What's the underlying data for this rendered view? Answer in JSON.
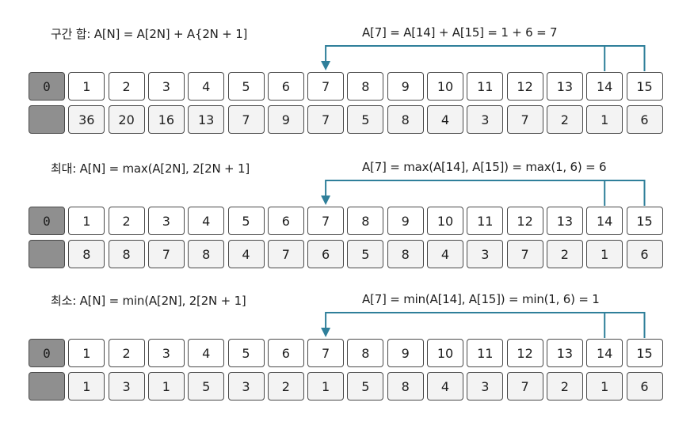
{
  "sections": [
    {
      "formula": "구간 합: A[N] = A[2N] + A{2N + 1]",
      "example": "A[7] = A[14] + A[15] = 1 + 6 = 7",
      "indices": [
        "0",
        "1",
        "2",
        "3",
        "4",
        "5",
        "6",
        "7",
        "8",
        "9",
        "10",
        "11",
        "12",
        "13",
        "14",
        "15"
      ],
      "values": [
        "",
        "36",
        "20",
        "16",
        "13",
        "7",
        "9",
        "7",
        "5",
        "8",
        "4",
        "3",
        "7",
        "2",
        "1",
        "6"
      ]
    },
    {
      "formula": "최대: A[N] = max(A[2N], 2[2N + 1]",
      "example": "A[7] = max(A[14], A[15]) = max(1, 6) = 6",
      "indices": [
        "0",
        "1",
        "2",
        "3",
        "4",
        "5",
        "6",
        "7",
        "8",
        "9",
        "10",
        "11",
        "12",
        "13",
        "14",
        "15"
      ],
      "values": [
        "",
        "8",
        "8",
        "7",
        "8",
        "4",
        "7",
        "6",
        "5",
        "8",
        "4",
        "3",
        "7",
        "2",
        "1",
        "6"
      ]
    },
    {
      "formula": "최소: A[N] = min(A[2N], 2[2N + 1]",
      "example": "A[7] = min(A[14], A[15]) = min(1, 6) = 1",
      "indices": [
        "0",
        "1",
        "2",
        "3",
        "4",
        "5",
        "6",
        "7",
        "8",
        "9",
        "10",
        "11",
        "12",
        "13",
        "14",
        "15"
      ],
      "values": [
        "",
        "1",
        "3",
        "1",
        "5",
        "3",
        "2",
        "1",
        "5",
        "8",
        "4",
        "3",
        "7",
        "2",
        "1",
        "6"
      ]
    }
  ],
  "colors": {
    "arrow": "#2f7f9a",
    "empty_cell": "#8f8f8f",
    "value_cell": "#f3f3f3",
    "border": "#4a4a4a"
  }
}
